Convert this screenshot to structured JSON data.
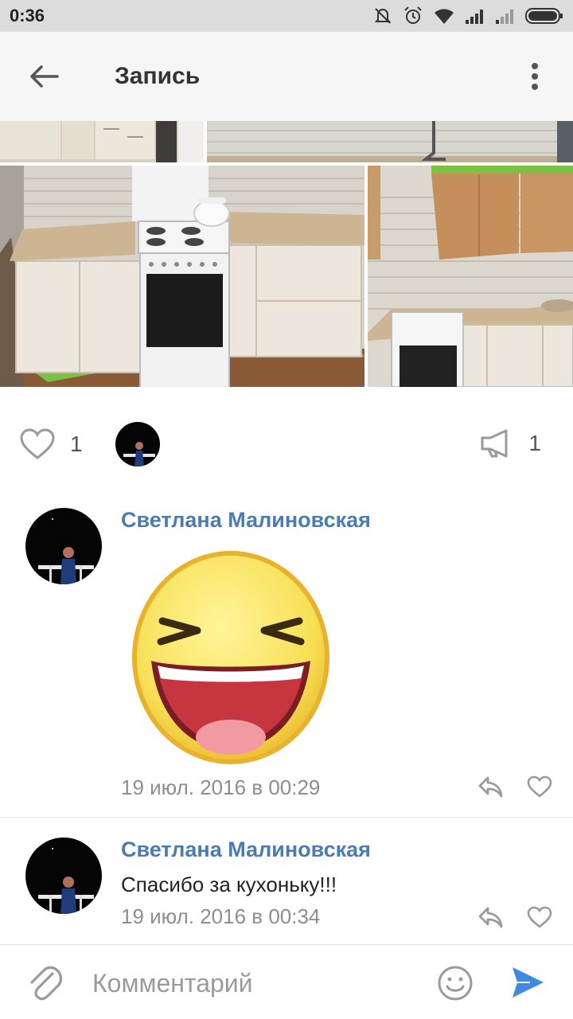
{
  "status_bar": {
    "time": "0:36",
    "icons": [
      "mute-alarm-icon",
      "alarm-clock-icon",
      "wifi-icon",
      "signal-icon",
      "signal-weak-icon",
      "battery-icon"
    ]
  },
  "app_bar": {
    "back_icon": "arrow-left-icon",
    "title": "Запись",
    "menu_icon": "more-vertical-icon"
  },
  "photos": {
    "items": [
      "kitchen-photo-top-left",
      "kitchen-photo-top-right",
      "kitchen-photo-stove",
      "kitchen-photo-cabinets"
    ]
  },
  "reactions": {
    "likes_count": "1",
    "shares_count": "1"
  },
  "comments": [
    {
      "author": "Светлана Малиновская",
      "sticker": "laughing-smiley-sticker",
      "text": "",
      "date": "19 июл. 2016 в 00:29"
    },
    {
      "author": "Светлана Малиновская",
      "text": "Спасибо за кухоньку!!!",
      "date": "19 июл. 2016 в 00:34"
    }
  ],
  "composer": {
    "placeholder": "Комментарий",
    "attach_icon": "paperclip-icon",
    "emoji_icon": "smiley-icon",
    "send_icon": "send-icon"
  },
  "colors": {
    "accent": "#4a7bb1",
    "send": "#3f8ae0",
    "icon_gray": "#999999"
  }
}
